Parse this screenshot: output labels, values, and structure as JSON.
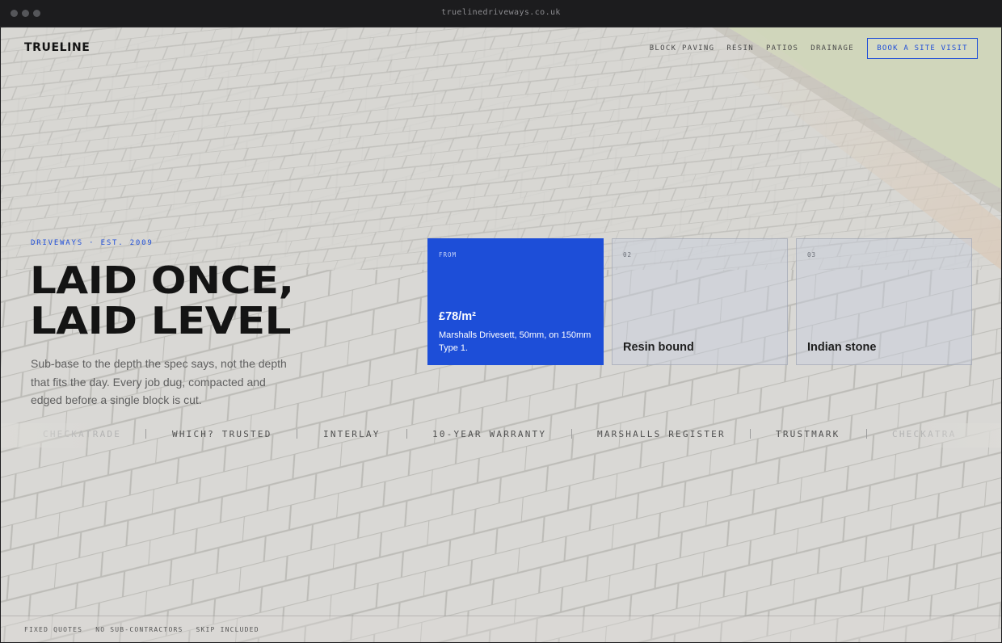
{
  "browser": {
    "url": "truelinedriveways.co.uk"
  },
  "nav": {
    "logo": "TRUELINE",
    "links": [
      "BLOCK PAVING",
      "RESIN",
      "PATIOS",
      "DRAINAGE"
    ],
    "cta_label": "BOOK A SITE VISIT"
  },
  "hero": {
    "eyebrow": "DRIVEWAYS · EST. 2009",
    "headline_line1": "LAID ONCE,",
    "headline_line2": "LAID LEVEL",
    "intro": "Sub-base to the depth the spec says, not the depth that fits the day. Every job dug, compacted and edged before a single block is cut."
  },
  "cards": [
    {
      "tag": "FROM",
      "price": "£78/m²",
      "description": "Marshalls Drivesett, 50mm, on 150mm Type 1."
    },
    {
      "tag": "02",
      "name": "Resin bound"
    },
    {
      "tag": "03",
      "name": "Indian stone"
    }
  ],
  "trust_strip": [
    "CHECKATRADE",
    "WHICH? TRUSTED",
    "INTERLAY",
    "10-YEAR WARRANTY",
    "MARSHALLS REGISTER",
    "TRUSTMARK",
    "CHECKATRA"
  ],
  "footer": {
    "items": [
      "FIXED QUOTES",
      "NO SUB-CONTRACTORS",
      "SKIP INCLUDED"
    ]
  },
  "colors": {
    "accent": "#1d4ed8",
    "ink": "#141414",
    "muted": "#5f5f5f"
  }
}
